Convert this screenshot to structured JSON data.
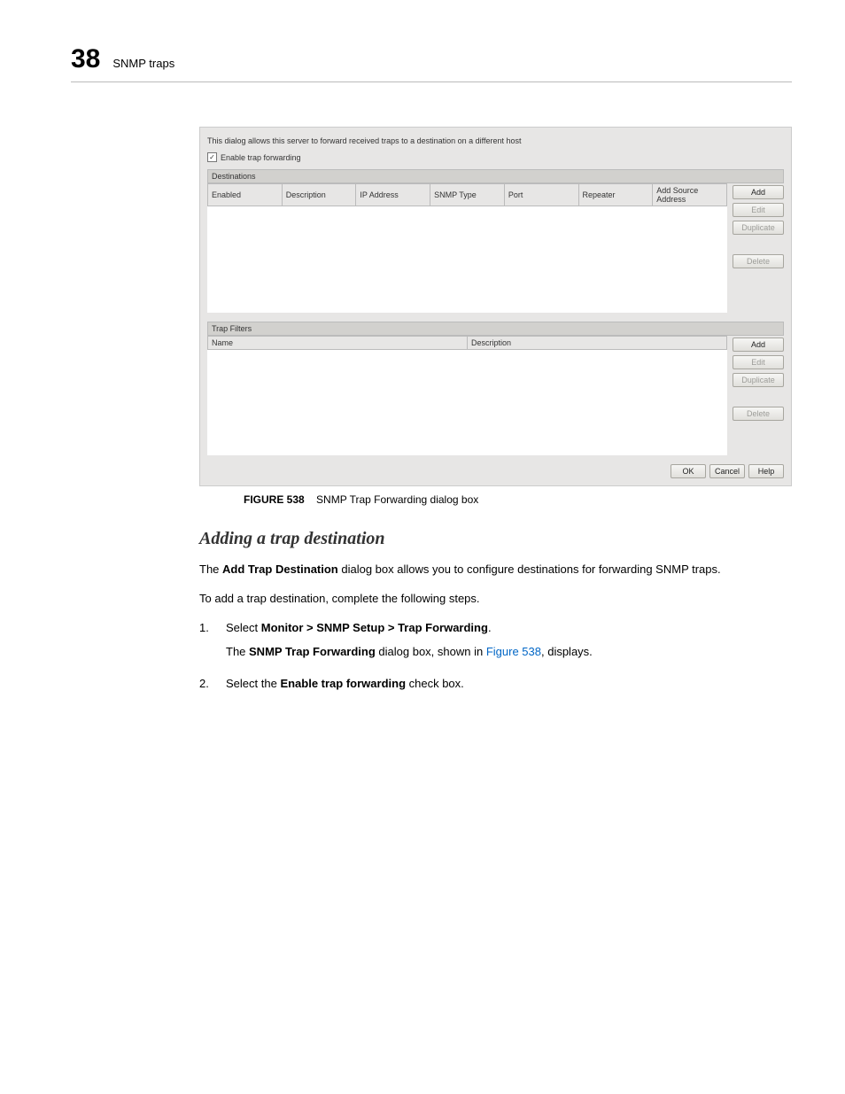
{
  "header": {
    "chapter_number": "38",
    "chapter_title": "SNMP traps"
  },
  "dialog": {
    "hint": "This dialog allows this server to forward received traps to a destination on a different host",
    "checkbox_label": "Enable trap forwarding",
    "destinations": {
      "title": "Destinations",
      "columns": [
        "Enabled",
        "Description",
        "IP Address",
        "SNMP Type",
        "Port",
        "Repeater",
        "Add Source Address"
      ],
      "buttons": {
        "add": "Add",
        "edit": "Edit",
        "duplicate": "Duplicate",
        "delete": "Delete"
      }
    },
    "filters": {
      "title": "Trap Filters",
      "columns": [
        "Name",
        "Description"
      ],
      "buttons": {
        "add": "Add",
        "edit": "Edit",
        "duplicate": "Duplicate",
        "delete": "Delete"
      }
    },
    "footer": {
      "ok": "OK",
      "cancel": "Cancel",
      "help": "Help"
    }
  },
  "figure": {
    "label": "FIGURE 538",
    "caption": "SNMP Trap Forwarding dialog box"
  },
  "section_heading": "Adding a trap destination",
  "para1_pre": "The ",
  "para1_bold": "Add Trap Destination",
  "para1_post": " dialog box allows you to configure destinations for forwarding SNMP traps.",
  "para2": "To add a trap destination, complete the following steps.",
  "steps": {
    "s1": {
      "num": "1.",
      "pre": "Select ",
      "bold": "Monitor > SNMP Setup > Trap Forwarding",
      "post": ".",
      "sub_pre": "The ",
      "sub_bold": "SNMP Trap Forwarding",
      "sub_mid": " dialog box, shown in ",
      "sub_link": "Figure 538",
      "sub_post": ", displays."
    },
    "s2": {
      "num": "2.",
      "pre": "Select the ",
      "bold": "Enable trap forwarding",
      "post": " check box."
    }
  }
}
